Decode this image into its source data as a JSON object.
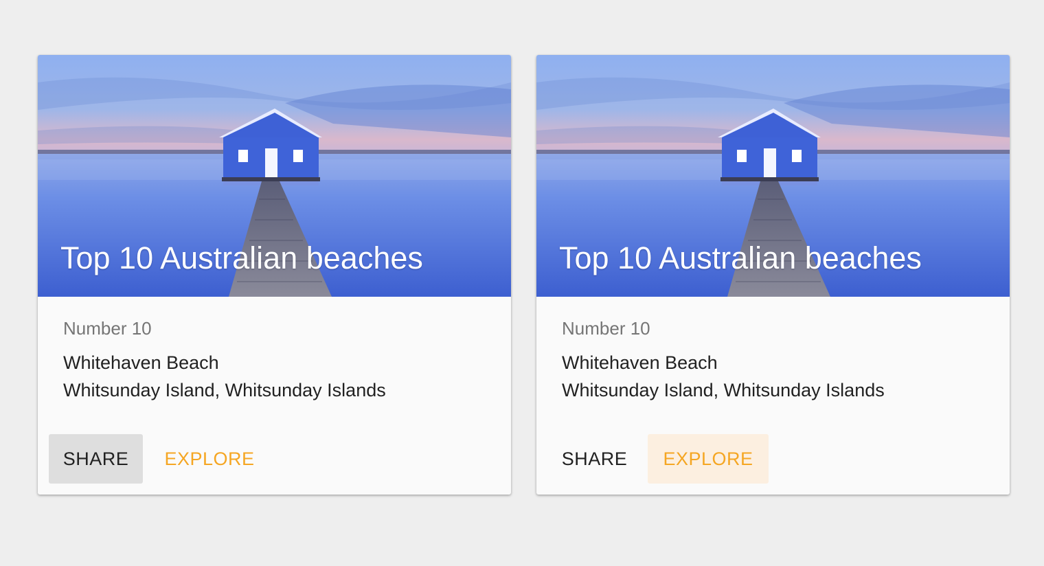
{
  "colors": {
    "background": "#eeeeee",
    "card": "#fafafa",
    "accent": "#f5a623",
    "share_hover": "#dedede",
    "explore_hover": "#fcefe0"
  },
  "cards": [
    {
      "image_icon": "boathouse-photo",
      "title": "Top 10 Australian beaches",
      "overline": "Number 10",
      "line1": "Whitehaven Beach",
      "line2": "Whitsunday Island, Whitsunday Islands",
      "share_label": "SHARE",
      "explore_label": "EXPLORE",
      "hovered_button": "share"
    },
    {
      "image_icon": "boathouse-photo",
      "title": "Top 10 Australian beaches",
      "overline": "Number 10",
      "line1": "Whitehaven Beach",
      "line2": "Whitsunday Island, Whitsunday Islands",
      "share_label": "SHARE",
      "explore_label": "EXPLORE",
      "hovered_button": "explore"
    }
  ]
}
